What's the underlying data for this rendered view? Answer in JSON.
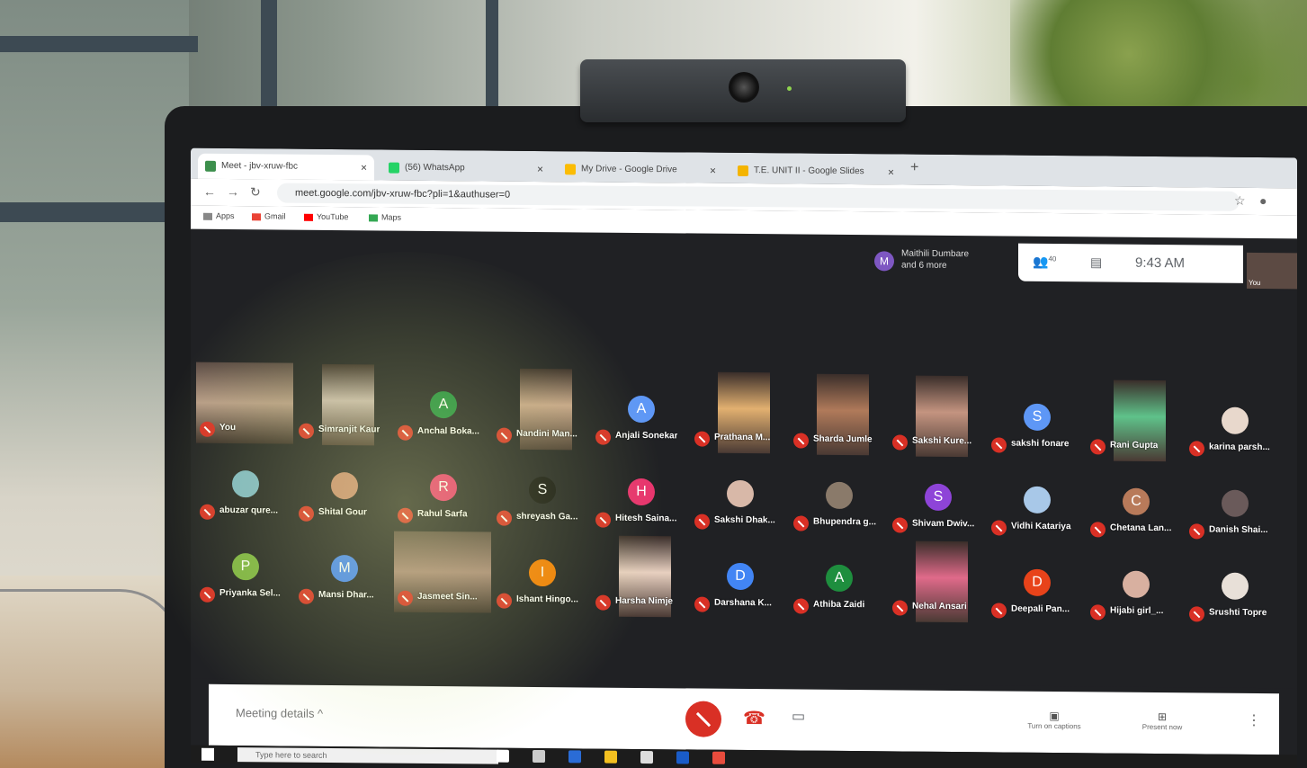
{
  "browser": {
    "tabs": [
      {
        "label": "Meet - jbv-xruw-fbc",
        "color": "#3c8f4c"
      },
      {
        "label": "(56) WhatsApp",
        "color": "#25d366"
      },
      {
        "label": "My Drive - Google Drive",
        "color": "#fbbc04"
      },
      {
        "label": "T.E. UNIT II - Google Slides",
        "color": "#f4b400"
      }
    ],
    "url": "meet.google.com/jbv-xruw-fbc?pli=1&authuser=0",
    "bookmarks": [
      {
        "label": "Apps",
        "color": "#888"
      },
      {
        "label": "Gmail",
        "color": "#ea4335"
      },
      {
        "label": "YouTube",
        "color": "#ff0000"
      },
      {
        "label": "Maps",
        "color": "#34a853"
      }
    ]
  },
  "meet": {
    "presence_initial": "M",
    "presence_name": "Maithili Dumbare",
    "presence_more": "and 6 more",
    "participant_count": "40",
    "time": "9:43 AM",
    "self_label": "You",
    "participants_row1": [
      {
        "name": "You",
        "kind": "wide",
        "color": "#b89c88"
      },
      {
        "name": "Simranjit Kaur",
        "kind": "photo",
        "color": "#c8b8ae"
      },
      {
        "name": "Anchal Boka...",
        "kind": "initial",
        "initial": "A",
        "color": "#1e8e3e"
      },
      {
        "name": "Nandini Man...",
        "kind": "photo",
        "color": "#c8a58c"
      },
      {
        "name": "Anjali Sonekar",
        "kind": "initial",
        "initial": "A",
        "color": "#5e97f6"
      },
      {
        "name": "Prathana M...",
        "kind": "photo",
        "color": "#e2b070"
      },
      {
        "name": "Sharda Jumle",
        "kind": "photo",
        "color": "#b07a5a"
      },
      {
        "name": "Sakshi Kure...",
        "kind": "photo",
        "color": "#c49480"
      },
      {
        "name": "sakshi fonare",
        "kind": "initial",
        "initial": "S",
        "color": "#5e97f6"
      },
      {
        "name": "Rani Gupta",
        "kind": "photo",
        "color": "#5fc28a"
      },
      {
        "name": "karina parsh...",
        "kind": "initial",
        "initial": "",
        "color": "#e8d8cc"
      }
    ],
    "participants_row2": [
      {
        "name": "abuzar qure...",
        "initial": "",
        "color": "#7eb8c8"
      },
      {
        "name": "Shital Gour",
        "initial": "",
        "color": "#c88a70"
      },
      {
        "name": "Rahul Sarfa",
        "initial": "R",
        "color": "#e8336e"
      },
      {
        "name": "shreyash Ga...",
        "initial": "S",
        "color": "#111111"
      },
      {
        "name": "Hitesh Saina...",
        "initial": "H",
        "color": "#e8336e"
      },
      {
        "name": "Sakshi Dhak...",
        "initial": "",
        "color": "#d8b8a8"
      },
      {
        "name": "Bhupendra g...",
        "initial": "",
        "color": "#8a7a6a"
      },
      {
        "name": "Shivam Dwiv...",
        "initial": "S",
        "color": "#8e44d8"
      },
      {
        "name": "Vidhi Katariya",
        "initial": "",
        "color": "#a8c8e8"
      },
      {
        "name": "Chetana Lan...",
        "initial": "C",
        "color": "#b87a5a"
      },
      {
        "name": "Danish Shai...",
        "initial": "",
        "color": "#6a5a5a"
      }
    ],
    "participants_row3": [
      {
        "name": "Priyanka Sel...",
        "kind": "initial",
        "initial": "P",
        "color": "#7cb342"
      },
      {
        "name": "Mansi Dhar...",
        "kind": "initial",
        "initial": "M",
        "color": "#4285f4"
      },
      {
        "name": "Jasmeet Sin...",
        "kind": "wide",
        "color": "#a8867a"
      },
      {
        "name": "Ishant Hingo...",
        "kind": "initial",
        "initial": "I",
        "color": "#f57c00"
      },
      {
        "name": "Harsha Nimje",
        "kind": "photo",
        "color": "#e8d0c0"
      },
      {
        "name": "Darshana K...",
        "kind": "initial",
        "initial": "D",
        "color": "#4285f4"
      },
      {
        "name": "Athiba Zaidi",
        "kind": "initial",
        "initial": "A",
        "color": "#1e8e3e"
      },
      {
        "name": "Nehal Ansari",
        "kind": "photo",
        "color": "#e06a8a"
      },
      {
        "name": "Deepali Pan...",
        "kind": "initial",
        "initial": "D",
        "color": "#e8431a"
      },
      {
        "name": "Hijabi girl_...",
        "kind": "initial",
        "initial": "",
        "color": "#d8b0a0"
      },
      {
        "name": "Srushti Topre",
        "kind": "initial",
        "initial": "",
        "color": "#e8e0d8"
      }
    ],
    "meeting_details": "Meeting details ^",
    "captions_label": "Turn on captions",
    "present_label": "Present now"
  },
  "taskbar": {
    "search_placeholder": "Type here to search"
  }
}
